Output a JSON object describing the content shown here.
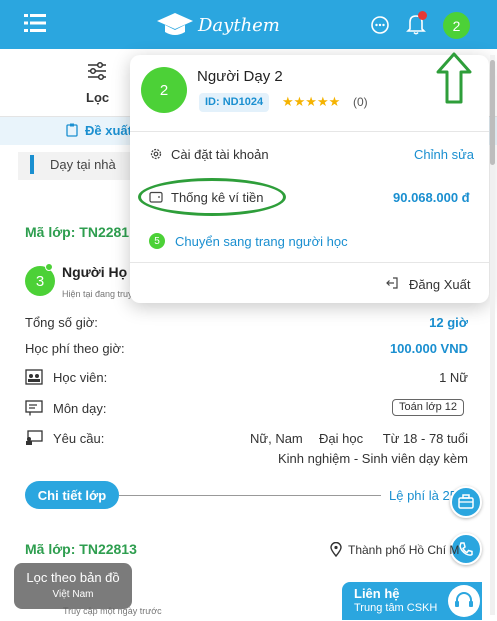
{
  "header": {
    "logo_text": "Daythem",
    "avatar_number": "2",
    "icons": [
      "menu-icon",
      "chat-icon",
      "bell-icon"
    ],
    "accent_color": "#2ba6df"
  },
  "filter": {
    "label": "Lọc"
  },
  "suggest": {
    "label": "Đề xuất"
  },
  "tabs": [
    {
      "label": "Dạy tại nhà"
    }
  ],
  "dropdown": {
    "avatar_number": "2",
    "name": "Người Dạy 2",
    "id_badge": "ID: ND1024",
    "stars": "★★★★★",
    "rating_count": "(0)",
    "settings_label": "Cài đặt tài khoản",
    "edit_label": "Chỉnh sửa",
    "wallet_label": "Thống kê ví tiền",
    "wallet_amount": "90.068.000 đ",
    "switch_number": "5",
    "switch_label": "Chuyển sang trang người học",
    "logout_label": "Đăng Xuất"
  },
  "class1": {
    "code": "Mã lớp: TN2281",
    "avatar_number": "3",
    "teacher_name": "Người Họ",
    "teacher_sub": "Hiện tại đang truy",
    "total_hours_label": "Tổng số giờ:",
    "total_hours_value": "12 giờ",
    "fee_per_hour_label": "Học phí theo giờ:",
    "fee_per_hour_value": "100.000 VND",
    "students_label": "Học viên:",
    "students_value": "1 Nữ",
    "subject_label": "Môn dạy:",
    "subject_value": "Toán lớp 12",
    "requirement_label": "Yêu cầu:",
    "requirement_gender": "Nữ, Nam",
    "requirement_level": "Đại học",
    "requirement_age": "Từ 18 - 78 tuổi",
    "requirement_experience": "Kinh nghiệm - Sinh viên dạy kèm",
    "detail_button": "Chi tiết lớp",
    "fee_text": "Lệ phí là 25"
  },
  "class2": {
    "code": "Mã lớp: TN22813",
    "location": "Thành phố Hồ Chí M",
    "access_text": "Truy cập một ngày trước"
  },
  "map_filter": {
    "title": "Lọc theo bản đồ",
    "subtitle": "Việt Nam"
  },
  "contact": {
    "title": "Liên hệ",
    "subtitle": "Trung tâm CSKH"
  }
}
